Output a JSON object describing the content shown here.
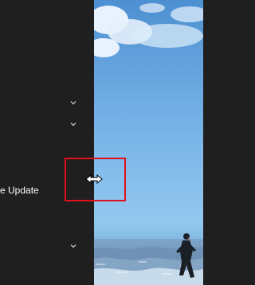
{
  "menu": {
    "label_partial": "e Update"
  },
  "icons": {
    "chevron": "chevron-down-icon",
    "cursor": "resize-horizontal-cursor-icon"
  },
  "colors": {
    "sidebar_bg": "#1f1f1f",
    "highlight": "#e0101b",
    "text": "#ffffff"
  }
}
